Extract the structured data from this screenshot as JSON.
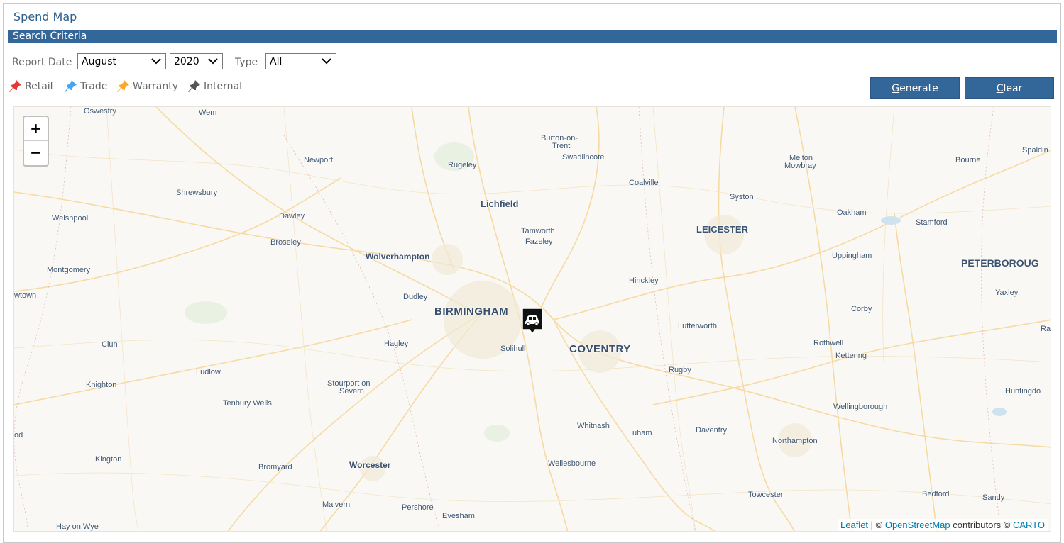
{
  "page": {
    "title": "Spend Map"
  },
  "criteria": {
    "header": "Search Criteria",
    "report_date_label": "Report Date",
    "month_value": "August",
    "year_value": "2020",
    "type_label": "Type",
    "type_value": "All"
  },
  "legend": {
    "retail": {
      "label": "Retail",
      "color": "#e53935"
    },
    "trade": {
      "label": "Trade",
      "color": "#42a5f5"
    },
    "warranty": {
      "label": "Warranty",
      "color": "#ffa726"
    },
    "internal": {
      "label": "Internal",
      "color": "#555555"
    }
  },
  "buttons": {
    "generate_first": "G",
    "generate_rest": "enerate",
    "clear_first": "C",
    "clear_rest": "lear"
  },
  "map": {
    "zoom_in": "+",
    "zoom_out": "−",
    "marker_icon": "car-icon",
    "places": [
      {
        "name": "Oswestry"
      },
      {
        "name": "Wem"
      },
      {
        "name": "Burton-on-"
      },
      {
        "name": "Trent"
      },
      {
        "name": "Swadlincote"
      },
      {
        "name": "Melton"
      },
      {
        "name": "Mowbray"
      },
      {
        "name": "Bourne"
      },
      {
        "name": "Spaldin"
      },
      {
        "name": "Newport"
      },
      {
        "name": "Rugeley"
      },
      {
        "name": "Coalville"
      },
      {
        "name": "Shrewsbury"
      },
      {
        "name": "Syston"
      },
      {
        "name": "Welshpool"
      },
      {
        "name": "Dawley"
      },
      {
        "name": "Lichfield"
      },
      {
        "name": "Oakham"
      },
      {
        "name": "Stamford"
      },
      {
        "name": "Tamworth"
      },
      {
        "name": "LEICESTER"
      },
      {
        "name": "Broseley"
      },
      {
        "name": "Fazeley"
      },
      {
        "name": "Wolverhampton"
      },
      {
        "name": "Uppingham"
      },
      {
        "name": "Montgomery"
      },
      {
        "name": "PETERBOROUG"
      },
      {
        "name": "Hinckley"
      },
      {
        "name": "Yaxley"
      },
      {
        "name": "wtown"
      },
      {
        "name": "Dudley"
      },
      {
        "name": "BIRMINGHAM"
      },
      {
        "name": "Corby"
      },
      {
        "name": "Lutterworth"
      },
      {
        "name": "Ra"
      },
      {
        "name": "Clun"
      },
      {
        "name": "Hagley"
      },
      {
        "name": "Solihull"
      },
      {
        "name": "COVENTRY"
      },
      {
        "name": "Rothwell"
      },
      {
        "name": "Kettering"
      },
      {
        "name": "Ludlow"
      },
      {
        "name": "Rugby"
      },
      {
        "name": "Knighton"
      },
      {
        "name": "Stourport on"
      },
      {
        "name": "Severn"
      },
      {
        "name": "Huntingdo"
      },
      {
        "name": "Tenbury Wells"
      },
      {
        "name": "Wellingborough"
      },
      {
        "name": "od"
      },
      {
        "name": "Whitnash"
      },
      {
        "name": "uham"
      },
      {
        "name": "Daventry"
      },
      {
        "name": "Northampton"
      },
      {
        "name": "Kington"
      },
      {
        "name": "Bromyard"
      },
      {
        "name": "Worcester"
      },
      {
        "name": "Wellesbourne"
      },
      {
        "name": "Towcester"
      },
      {
        "name": "Bedford"
      },
      {
        "name": "Sandy"
      },
      {
        "name": "Malvern"
      },
      {
        "name": "Pershore"
      },
      {
        "name": "Evesham"
      },
      {
        "name": "Hay on Wye"
      }
    ],
    "attribution": {
      "leaflet": "Leaflet",
      "sep": " | © ",
      "osm": "OpenStreetMap",
      "contrib": " contributors © ",
      "carto": "CARTO"
    }
  }
}
